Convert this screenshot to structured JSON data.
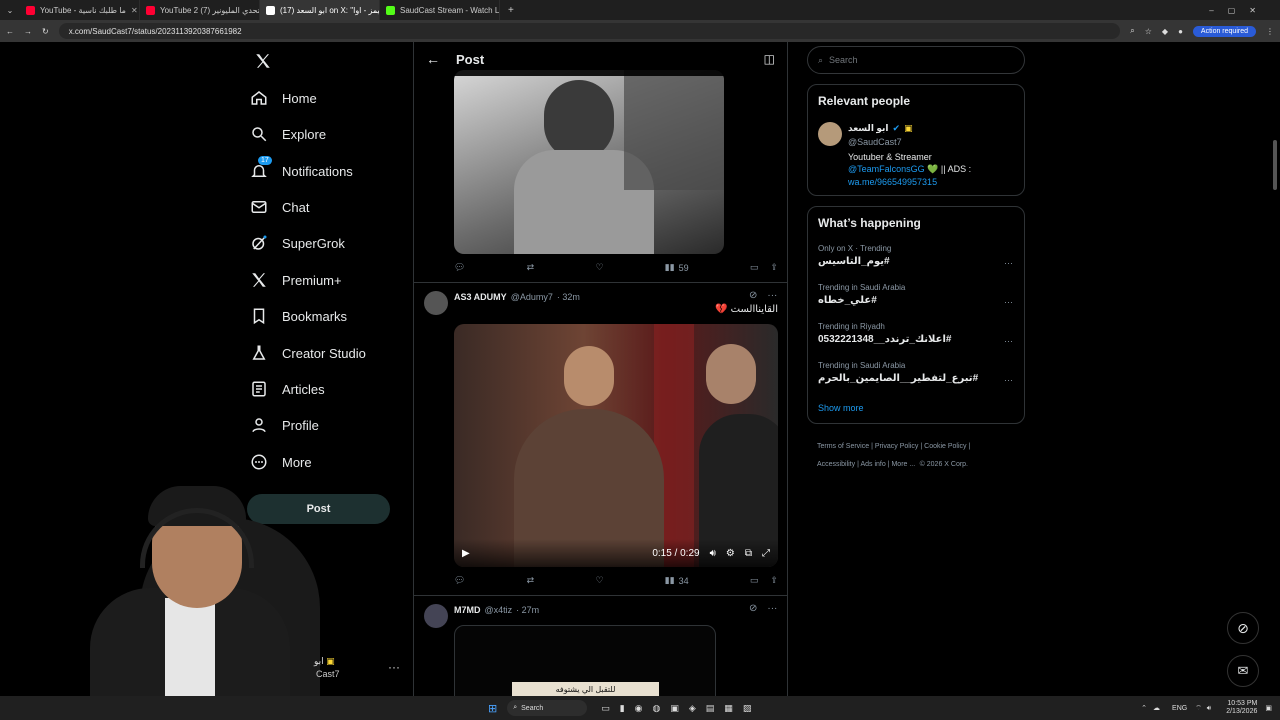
{
  "browser": {
    "tabs": [
      {
        "title": "YouTube - ما طلبك ناسية",
        "color": "#ff0033"
      },
      {
        "title": "YouTube 2 (7) تحدي المليونير",
        "color": "#ff0033"
      },
      {
        "title": "(17) ابو السعد on X: \"ميمز - اوا...",
        "color": "#ffffff",
        "active": true
      },
      {
        "title": "SaudCast Stream - Watch Live ...",
        "color": "#53fc18"
      }
    ],
    "new_tab": "+",
    "url": "x.com/SaudCast7/status/2023113920387661982",
    "action_required": "Action required"
  },
  "nav": {
    "home": "Home",
    "explore": "Explore",
    "notifications": "Notifications",
    "notifications_badge": "17",
    "chat": "Chat",
    "supergrok": "SuperGrok",
    "premium": "Premium+",
    "bookmarks": "Bookmarks",
    "creator_studio": "Creator Studio",
    "articles": "Articles",
    "profile": "Profile",
    "more": "More",
    "post_button": "Post",
    "account_name": "ابو",
    "account_handle": "Cast7"
  },
  "header": {
    "title": "Post"
  },
  "posts": [
    {
      "views": "59"
    },
    {
      "name": "AS3 ADUMY",
      "handle": "@Adumy7",
      "time": "· 32m",
      "text": "القايناالست 💔",
      "video_time": "0:15 / 0:29",
      "views": "34"
    },
    {
      "name": "M7MD",
      "handle": "@x4tiz",
      "time": "· 27m",
      "caption": "للتقبل الي يشتوفه"
    }
  ],
  "search": {
    "placeholder": "Search"
  },
  "relevant": {
    "title": "Relevant people",
    "name": "ابو السعد",
    "handle": "@SaudCast7",
    "bio_line1": "Youtuber & Streamer",
    "bio_mention": "@TeamFalconsGG",
    "bio_rest": "💚 || ADS :",
    "bio_link": "wa.me/966549957315"
  },
  "happening": {
    "title": "What’s happening",
    "trends": [
      {
        "meta": "Only on X · Trending",
        "tag": "#يوم_التاسيس"
      },
      {
        "meta": "Trending in Saudi Arabia",
        "tag": "#علي_خطاه"
      },
      {
        "meta": "Trending in Riyadh",
        "tag": "#اعلانك_ترندد__0532221348"
      },
      {
        "meta": "Trending in Saudi Arabia",
        "tag": "#تبرع_لتفطير__الصايمين_بالحرم"
      }
    ],
    "show_more": "Show more"
  },
  "footer": {
    "terms": "Terms of Service",
    "privacy": "Privacy Policy",
    "cookie": "Cookie Policy",
    "accessibility": "Accessibility",
    "ads": "Ads info",
    "more": "More ...",
    "copyright": "© 2026 X Corp."
  },
  "taskbar": {
    "search": "Search",
    "lang": "ENG",
    "time": "10:53 PM",
    "date": "2/13/2026"
  },
  "colors": {
    "accent": "#1d9bf0",
    "bg": "#000000",
    "border": "#2f3336"
  }
}
